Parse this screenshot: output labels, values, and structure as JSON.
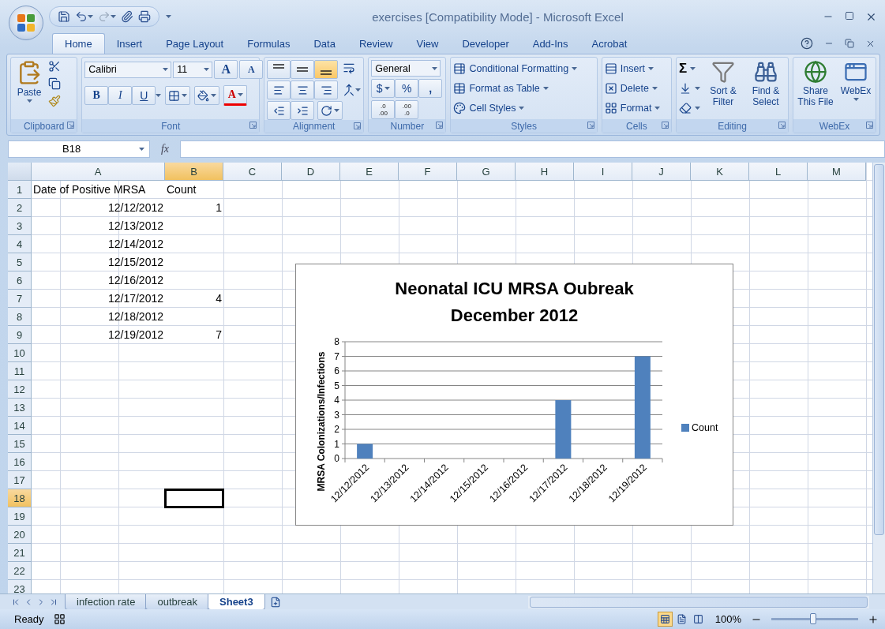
{
  "window": {
    "title": "exercises  [Compatibility Mode] - Microsoft Excel"
  },
  "ribbon_tabs": [
    {
      "label": "Home",
      "selected": true
    },
    {
      "label": "Insert",
      "selected": false
    },
    {
      "label": "Page Layout",
      "selected": false
    },
    {
      "label": "Formulas",
      "selected": false
    },
    {
      "label": "Data",
      "selected": false
    },
    {
      "label": "Review",
      "selected": false
    },
    {
      "label": "View",
      "selected": false
    },
    {
      "label": "Developer",
      "selected": false
    },
    {
      "label": "Add-Ins",
      "selected": false
    },
    {
      "label": "Acrobat",
      "selected": false
    }
  ],
  "ribbon": {
    "clipboard": {
      "label": "Clipboard",
      "paste": "Paste"
    },
    "font": {
      "label": "Font",
      "font_name": "Calibri",
      "font_size": "11",
      "grow": "A",
      "shrink": "A",
      "bold": "B",
      "italic": "I",
      "underline": "U",
      "font_color": "A"
    },
    "alignment": {
      "label": "Alignment",
      "vertical_align": [
        {
          "kind": "top",
          "selected": false
        },
        {
          "kind": "middle",
          "selected": false
        },
        {
          "kind": "bottom",
          "selected": true
        }
      ]
    },
    "number": {
      "label": "Number",
      "format": "General",
      "currency": "$",
      "percent": "%",
      "comma": ",",
      "increase_decimal": [
        ".0",
        ".00"
      ],
      "decrease_decimal": [
        ".00",
        ".0"
      ]
    },
    "styles": {
      "label": "Styles",
      "buttons": [
        "Conditional Formatting",
        "Format as Table",
        "Cell Styles"
      ]
    },
    "cells": {
      "label": "Cells",
      "buttons": [
        "Insert",
        "Delete",
        "Format"
      ]
    },
    "editing": {
      "label": "Editing",
      "sum": "Σ",
      "sort": "Sort & Filter",
      "find": "Find & Select"
    },
    "webex": {
      "label": "WebEx",
      "share": "Share This File",
      "webex": "WebEx"
    }
  },
  "formula_bar": {
    "name_box": "B18",
    "fx": "fx"
  },
  "sheet": {
    "columns": [
      {
        "label": "A",
        "selected": false
      },
      {
        "label": "B",
        "selected": true
      },
      {
        "label": "C",
        "selected": false
      },
      {
        "label": "D",
        "selected": false
      },
      {
        "label": "E",
        "selected": false
      },
      {
        "label": "F",
        "selected": false
      },
      {
        "label": "G",
        "selected": false
      },
      {
        "label": "H",
        "selected": false
      },
      {
        "label": "I",
        "selected": false
      },
      {
        "label": "J",
        "selected": false
      },
      {
        "label": "K",
        "selected": false
      },
      {
        "label": "L",
        "selected": false
      },
      {
        "label": "M",
        "selected": false
      }
    ],
    "rows": [
      {
        "label": "1",
        "selected": false,
        "cells": [
          {
            "value": "Date of Positive MRSA",
            "kind": "text"
          },
          {
            "value": "Count",
            "kind": "text"
          }
        ]
      },
      {
        "label": "2",
        "selected": false,
        "cells": [
          {
            "value": "12/12/2012",
            "kind": "number"
          },
          {
            "value": "1",
            "kind": "number"
          }
        ]
      },
      {
        "label": "3",
        "selected": false,
        "cells": [
          {
            "value": "12/13/2012",
            "kind": "number"
          }
        ]
      },
      {
        "label": "4",
        "selected": false,
        "cells": [
          {
            "value": "12/14/2012",
            "kind": "number"
          }
        ]
      },
      {
        "label": "5",
        "selected": false,
        "cells": [
          {
            "value": "12/15/2012",
            "kind": "number"
          }
        ]
      },
      {
        "label": "6",
        "selected": false,
        "cells": [
          {
            "value": "12/16/2012",
            "kind": "number"
          }
        ]
      },
      {
        "label": "7",
        "selected": false,
        "cells": [
          {
            "value": "12/17/2012",
            "kind": "number"
          },
          {
            "value": "4",
            "kind": "number"
          }
        ]
      },
      {
        "label": "8",
        "selected": false,
        "cells": [
          {
            "value": "12/18/2012",
            "kind": "number"
          }
        ]
      },
      {
        "label": "9",
        "selected": false,
        "cells": [
          {
            "value": "12/19/2012",
            "kind": "number"
          },
          {
            "value": "7",
            "kind": "number"
          }
        ]
      },
      {
        "label": "10",
        "selected": false
      },
      {
        "label": "11",
        "selected": false
      },
      {
        "label": "12",
        "selected": false
      },
      {
        "label": "13",
        "selected": false
      },
      {
        "label": "14",
        "selected": false
      },
      {
        "label": "15",
        "selected": false
      },
      {
        "label": "16",
        "selected": false
      },
      {
        "label": "17",
        "selected": false
      },
      {
        "label": "18",
        "selected": true
      },
      {
        "label": "19",
        "selected": false
      },
      {
        "label": "20",
        "selected": false
      },
      {
        "label": "21",
        "selected": false
      },
      {
        "label": "22",
        "selected": false
      },
      {
        "label": "23",
        "selected": false
      }
    ]
  },
  "chart": {
    "chart_data": {
      "type": "bar",
      "title": "Neonatal ICU MRSA Oubreak December 2012",
      "ylabel": "MRSA Colonizations/Infections",
      "categories": [
        "12/12/2012",
        "12/13/2012",
        "12/14/2012",
        "12/15/2012",
        "12/16/2012",
        "12/17/2012",
        "12/18/2012",
        "12/19/2012"
      ],
      "series": [
        {
          "name": "Count",
          "color": "#4f81bd",
          "values": [
            1,
            null,
            null,
            null,
            null,
            4,
            null,
            7
          ]
        }
      ],
      "ylim": [
        0,
        8
      ],
      "yticks": [
        0,
        1,
        2,
        3,
        4,
        5,
        6,
        7,
        8
      ],
      "grid": true
    }
  },
  "sheet_tabs": [
    {
      "label": "infection rate",
      "selected": false
    },
    {
      "label": "outbreak",
      "selected": false
    },
    {
      "label": "Sheet3",
      "selected": true
    }
  ],
  "status_bar": {
    "status": "Ready",
    "views": [
      {
        "kind": "normal",
        "selected": true
      },
      {
        "kind": "layout",
        "selected": false
      },
      {
        "kind": "break",
        "selected": false
      }
    ],
    "zoom": "100%",
    "zoom_slider": {
      "level": 0.48
    }
  }
}
